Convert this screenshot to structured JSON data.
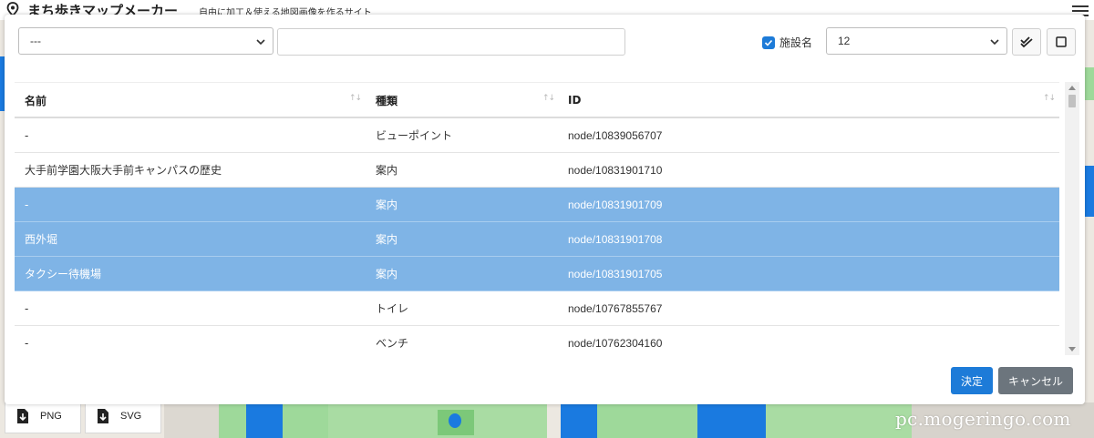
{
  "app": {
    "title": "まち歩きマップメーカー",
    "subtitle": "自由に加工＆使える地図画像を作るサイト",
    "logo_icon": "map-pin-icon",
    "menu_icon": "hamburger-icon"
  },
  "toolbar": {
    "category_select": {
      "value": "---"
    },
    "search": {
      "value": "",
      "placeholder": ""
    },
    "facility_checkbox": {
      "label": "施設名",
      "checked": true
    },
    "size_select": {
      "value": "12"
    },
    "check_all_icon": "double-check-icon",
    "uncheck_all_icon": "empty-square-icon"
  },
  "table": {
    "columns": [
      {
        "label": "名前",
        "sort_icon": "↑↓"
      },
      {
        "label": "種類",
        "sort_icon": "↑↓"
      },
      {
        "label": "ID",
        "sort_icon": "↑↓"
      }
    ],
    "rows": [
      {
        "name": "-",
        "type": "ビューポイント",
        "id": "node/10839056707",
        "selected": false
      },
      {
        "name": "大手前学園大阪大手前キャンパスの歴史",
        "type": "案内",
        "id": "node/10831901710",
        "selected": false
      },
      {
        "name": "-",
        "type": "案内",
        "id": "node/10831901709",
        "selected": true
      },
      {
        "name": "西外堀",
        "type": "案内",
        "id": "node/10831901708",
        "selected": true
      },
      {
        "name": "タクシー待機場",
        "type": "案内",
        "id": "node/10831901705",
        "selected": true
      },
      {
        "name": "-",
        "type": "トイレ",
        "id": "node/10767855767",
        "selected": false
      },
      {
        "name": "-",
        "type": "ベンチ",
        "id": "node/10762304160",
        "selected": false
      }
    ]
  },
  "buttons": {
    "ok": "決定",
    "cancel": "キャンセル"
  },
  "export": {
    "png": "PNG",
    "svg": "SVG",
    "icon": "download-file-icon"
  },
  "watermark": "pc.mogeringo.com",
  "colors": {
    "accent": "#1d7bd8",
    "selected_row": "#7fb4e6",
    "cancel": "#6c757d",
    "map_green": "#9ed99a",
    "map_water": "#1a7ae0"
  }
}
